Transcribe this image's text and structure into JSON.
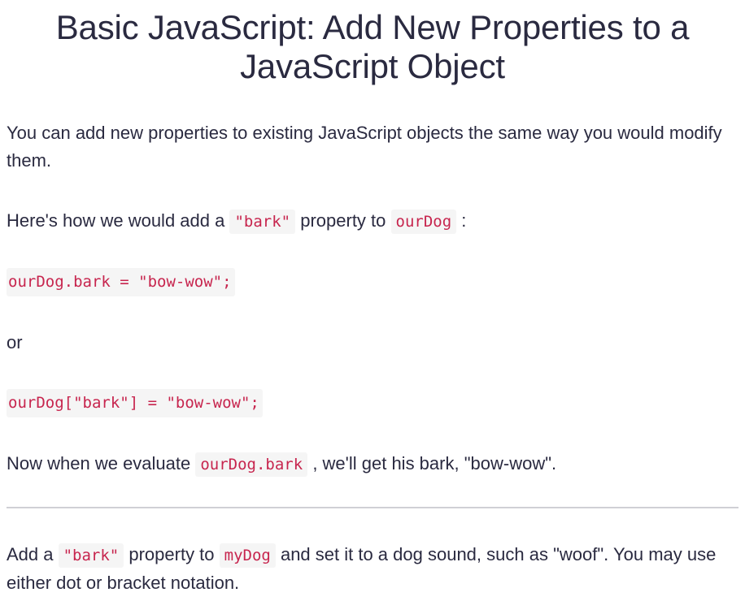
{
  "title": "Basic JavaScript: Add New Properties to a JavaScript Object",
  "para1": "You can add new properties to existing JavaScript objects the same way you would modify them.",
  "para2": {
    "before": "Here's how we would add a ",
    "code1": "\"bark\"",
    "middle": " property to ",
    "code2": "ourDog",
    "after": " :"
  },
  "code_example_1": "ourDog.bark = \"bow-wow\";",
  "or_text": "or",
  "code_example_2": "ourDog[\"bark\"] = \"bow-wow\";",
  "para3": {
    "before": "Now when we evaluate ",
    "code": "ourDog.bark",
    "after": " , we'll get his bark, \"bow-wow\"."
  },
  "para4": {
    "before": "Add a ",
    "code1": "\"bark\"",
    "middle": " property to ",
    "code2": "myDog",
    "after": " and set it to a dog sound, such as \"woof\". You may use either dot or bracket notation."
  }
}
